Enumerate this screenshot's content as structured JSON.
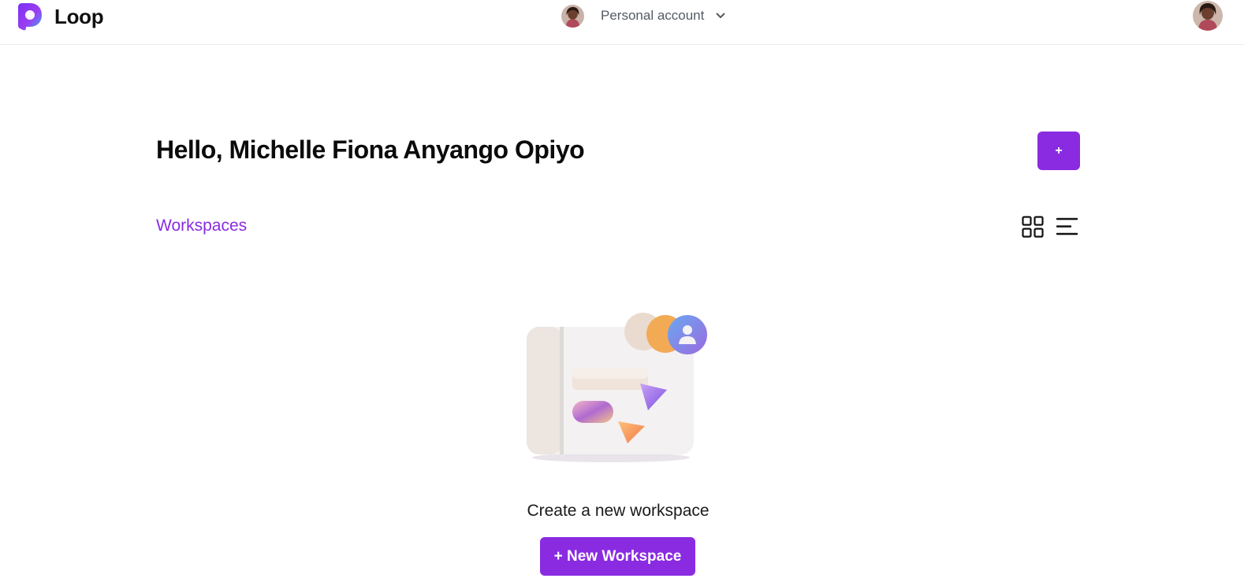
{
  "app": {
    "brand": "Loop",
    "logo_icon": "loop-logo-icon"
  },
  "account": {
    "label": "Personal account",
    "avatar_icon": "user-avatar",
    "chevron_icon": "chevron-down-icon"
  },
  "main": {
    "greeting": "Hello, Michelle Fiona Anyango Opiyo",
    "add_label": "+",
    "workspaces_title": "Workspaces",
    "grid_view_icon": "grid-view-icon",
    "list_view_icon": "list-view-icon",
    "empty_state_text": "Create a new workspace",
    "new_workspace_label": "+ New Workspace"
  },
  "colors": {
    "accent": "#8a2be2",
    "text": "#111111",
    "muted": "#555a66"
  }
}
